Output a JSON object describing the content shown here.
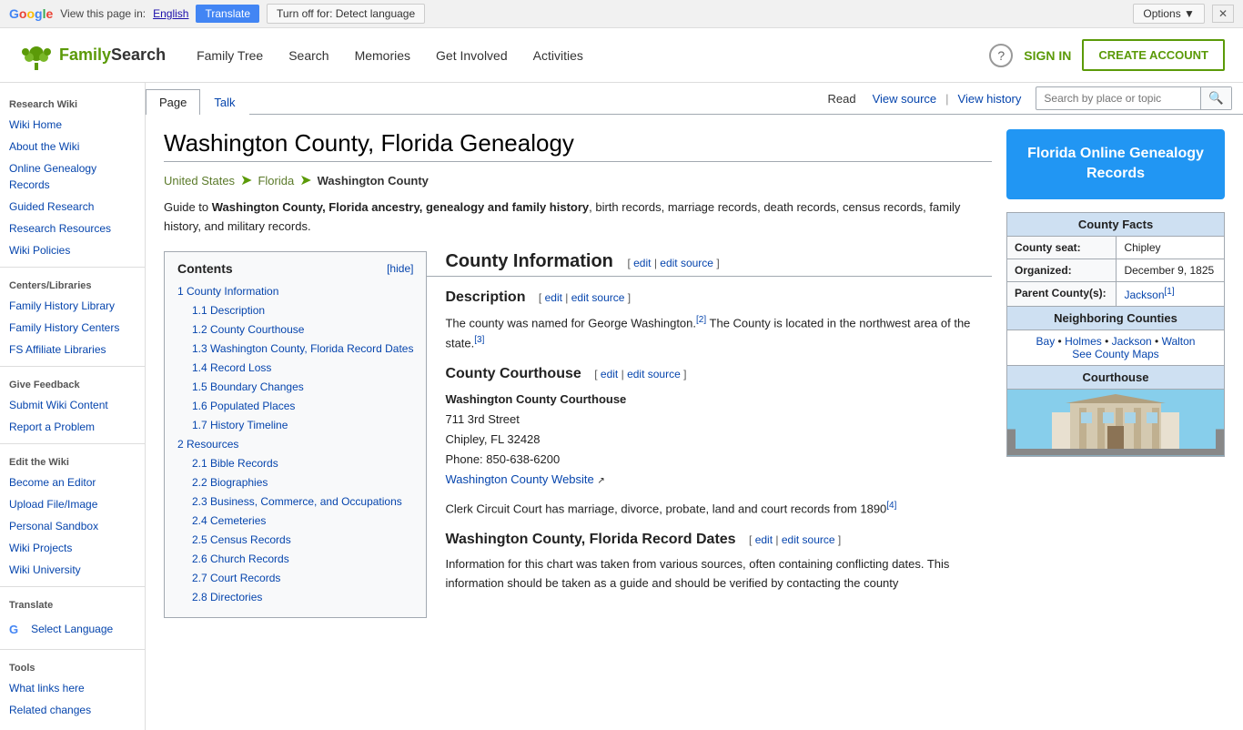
{
  "translate_bar": {
    "google_label": "Google",
    "view_label": "View this page in:",
    "language": "English",
    "translate_btn": "Translate",
    "turnoff_btn": "Turn off for: Detect language",
    "options_btn": "Options ▼",
    "close_btn": "✕"
  },
  "header": {
    "logo_text_green": "Family",
    "logo_text_dark": "Search",
    "nav_items": [
      "Family Tree",
      "Search",
      "Memories",
      "Get Involved",
      "Activities"
    ],
    "sign_in": "SIGN IN",
    "create_account": "CREATE ACCOUNT"
  },
  "sidebar": {
    "research_wiki_label": "Research Wiki",
    "items_research": [
      {
        "label": "Wiki Home",
        "href": "#"
      },
      {
        "label": "About the Wiki",
        "href": "#"
      },
      {
        "label": "Online Genealogy Records",
        "href": "#"
      },
      {
        "label": "Guided Research",
        "href": "#"
      },
      {
        "label": "Research Resources",
        "href": "#"
      },
      {
        "label": "Wiki Policies",
        "href": "#"
      }
    ],
    "centers_label": "Centers/Libraries",
    "items_centers": [
      {
        "label": "Family History Library",
        "href": "#"
      },
      {
        "label": "Family History Centers",
        "href": "#"
      },
      {
        "label": "FS Affiliate Libraries",
        "href": "#"
      }
    ],
    "feedback_label": "Give Feedback",
    "items_feedback": [
      {
        "label": "Submit Wiki Content",
        "href": "#"
      },
      {
        "label": "Report a Problem",
        "href": "#"
      }
    ],
    "edit_label": "Edit the Wiki",
    "items_edit": [
      {
        "label": "Become an Editor",
        "href": "#"
      },
      {
        "label": "Upload File/Image",
        "href": "#"
      },
      {
        "label": "Personal Sandbox",
        "href": "#"
      },
      {
        "label": "Wiki Projects",
        "href": "#"
      },
      {
        "label": "Wiki University",
        "href": "#"
      }
    ],
    "translate_label": "Translate",
    "select_language": "Select Language",
    "tools_label": "Tools",
    "items_tools": [
      {
        "label": "What links here",
        "href": "#"
      },
      {
        "label": "Related changes",
        "href": "#"
      }
    ]
  },
  "tab_bar": {
    "tab_page": "Page",
    "tab_talk": "Talk",
    "read": "Read",
    "view_source": "View source",
    "view_history": "View history",
    "search_placeholder": "Search by place or topic"
  },
  "article": {
    "title": "Washington County, Florida Genealogy",
    "breadcrumb_us": "United States",
    "breadcrumb_fl": "Florida",
    "breadcrumb_current": "Washington County",
    "intro": "Guide to ",
    "intro_bold": "Washington County, Florida ancestry, genealogy and family history",
    "intro_rest": ", birth records, marriage records, death records, census records, family history, and military records.",
    "contents_title": "Contents",
    "contents_hide": "[hide]",
    "toc": [
      {
        "num": "1",
        "label": "County Information",
        "level": 0
      },
      {
        "num": "1.1",
        "label": "Description",
        "level": 1
      },
      {
        "num": "1.2",
        "label": "County Courthouse",
        "level": 1
      },
      {
        "num": "1.3",
        "label": "Washington County, Florida Record Dates",
        "level": 1
      },
      {
        "num": "1.4",
        "label": "Record Loss",
        "level": 1
      },
      {
        "num": "1.5",
        "label": "Boundary Changes",
        "level": 1
      },
      {
        "num": "1.6",
        "label": "Populated Places",
        "level": 1
      },
      {
        "num": "1.7",
        "label": "History Timeline",
        "level": 1
      },
      {
        "num": "2",
        "label": "Resources",
        "level": 0
      },
      {
        "num": "2.1",
        "label": "Bible Records",
        "level": 1
      },
      {
        "num": "2.2",
        "label": "Biographies",
        "level": 1
      },
      {
        "num": "2.3",
        "label": "Business, Commerce, and Occupations",
        "level": 1
      },
      {
        "num": "2.4",
        "label": "Cemeteries",
        "level": 1
      },
      {
        "num": "2.5",
        "label": "Census Records",
        "level": 1
      },
      {
        "num": "2.6",
        "label": "Church Records",
        "level": 1
      },
      {
        "num": "2.7",
        "label": "Court Records",
        "level": 1
      },
      {
        "num": "2.8",
        "label": "Directories",
        "level": 1
      }
    ],
    "section_county_info": "County Information",
    "section_description": "Description",
    "desc_edit": "edit",
    "desc_edit_source": "edit source",
    "desc_text": "The county was named for George Washington.",
    "desc_sup1": "[2]",
    "desc_text2": " The County is located in the northwest area of the state.",
    "desc_sup2": "[3]",
    "section_courthouse": "County Courthouse",
    "courthouse_edit": "edit",
    "courthouse_edit_source": "edit source",
    "courthouse_name": "Washington County Courthouse",
    "courthouse_street": "711 3rd Street",
    "courthouse_city": "Chipley, FL 32428",
    "courthouse_phone": "Phone: 850-638-6200",
    "courthouse_website": "Washington County Website",
    "courthouse_clerk": "Clerk Circuit Court has marriage, divorce, probate, land and court records from 1890",
    "courthouse_sup": "[4]",
    "section_record_dates": "Washington County, Florida Record Dates",
    "record_dates_edit": "edit",
    "record_dates_edit_source": "edit source",
    "record_dates_text": "Information for this chart was taken from various sources, often containing conflicting dates. This information should be taken as a guide and should be verified by contacting the county",
    "county_facts": {
      "title": "County Facts",
      "seat_label": "County seat:",
      "seat_value": "Chipley",
      "organized_label": "Organized:",
      "organized_value": "December 9, 1825",
      "parent_label": "Parent County(s):",
      "parent_value": "Jackson",
      "parent_sup": "[1]"
    },
    "neighboring": {
      "title": "Neighboring Counties",
      "counties": "Bay • Holmes • Jackson • Walton",
      "map_link": "See County Maps"
    },
    "courthouse_panel": {
      "title": "Courthouse"
    },
    "florida_btn": "Florida Online Genealogy Records"
  }
}
